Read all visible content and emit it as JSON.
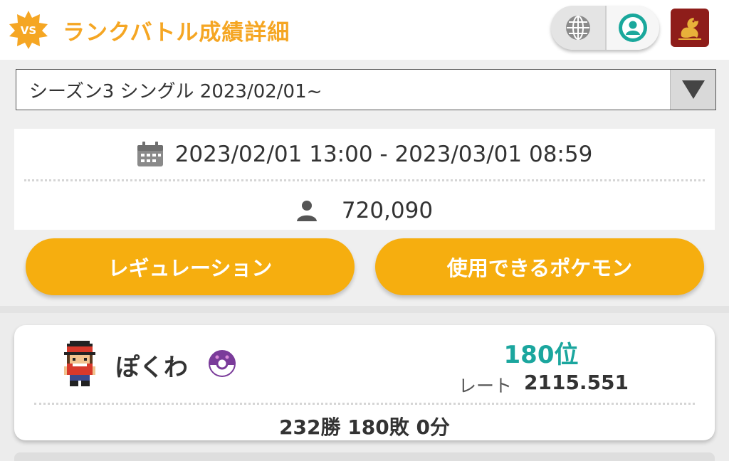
{
  "header": {
    "vs_badge_text": "VS",
    "title": "ランクバトル成績詳細",
    "accent_color": "#f5a623",
    "globe_icon": "globe-icon",
    "profile_icon": "profile-icon",
    "emblem_icon": "dragon-emblem-icon"
  },
  "season_select": {
    "selected": "シーズン3 シングル 2023/02/01~",
    "arrow_icon": "triangle-down-icon"
  },
  "info": {
    "period": "2023/02/01 13:00 - 2023/03/01 08:59",
    "players": "720,090",
    "calendar_icon": "calendar-icon",
    "person_icon": "person-icon"
  },
  "buttons": {
    "regulation": "レギュレーション",
    "usable_pokemon": "使用できるポケモン",
    "color": "#f6ae0f"
  },
  "player": {
    "name": "ぽくわ",
    "rank": "180位",
    "rate_label": "レート",
    "rate_value": "2115.551",
    "record": "232勝 180敗 0分",
    "rank_color": "#1ba69e",
    "ball_icon": "master-ball-icon",
    "avatar_icon": "trainer-avatar-icon"
  }
}
